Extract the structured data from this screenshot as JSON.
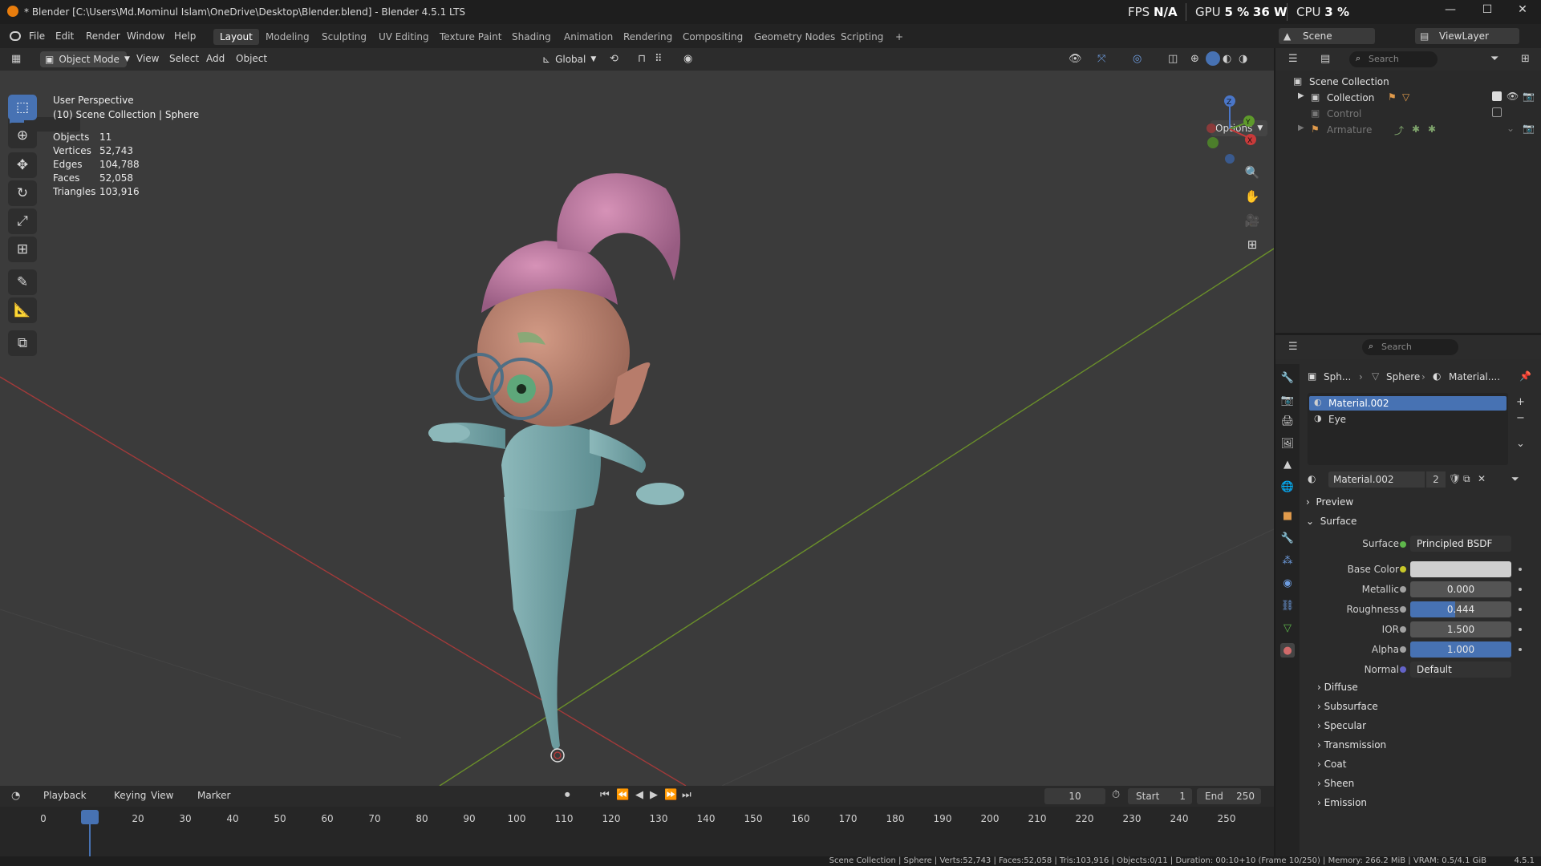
{
  "titlebar": {
    "title": "* Blender [C:\\Users\\Md.Mominul Islam\\OneDrive\\Desktop\\Blender.blend] - Blender 4.5.1 LTS",
    "fps_label": "FPS",
    "fps_value": "N/A",
    "gpu_label": "GPU",
    "gpu_value": "5 %",
    "gpu_power": "36 W",
    "cpu_label": "CPU",
    "cpu_value": "3 %",
    "minimize": "—",
    "maximize": "☐",
    "close": "✕"
  },
  "menubar": {
    "menus": [
      "File",
      "Edit",
      "Render",
      "Window",
      "Help"
    ],
    "workspaces": [
      "Layout",
      "Modeling",
      "Sculpting",
      "UV Editing",
      "Texture Paint",
      "Shading",
      "Animation",
      "Rendering",
      "Compositing",
      "Geometry Nodes",
      "Scripting"
    ],
    "active_workspace": "Layout",
    "add_tab": "+",
    "scene": "Scene",
    "view_layer": "ViewLayer"
  },
  "viewport": {
    "mode": "Object Mode",
    "menus": [
      "View",
      "Select",
      "Add",
      "Object"
    ],
    "orientation": "Global",
    "options": "Options",
    "perspective": "User Perspective",
    "context": "(10) Scene Collection | Sphere",
    "stats": [
      {
        "label": "Objects",
        "value": "11"
      },
      {
        "label": "Vertices",
        "value": "52,743"
      },
      {
        "label": "Edges",
        "value": "104,788"
      },
      {
        "label": "Faces",
        "value": "52,058"
      },
      {
        "label": "Triangles",
        "value": "103,916"
      }
    ],
    "tools": [
      "select-box-icon",
      "cursor-icon",
      "move-icon",
      "rotate-icon",
      "scale-icon",
      "transform-icon",
      "annotate-icon",
      "measure-icon",
      "add-cube-icon"
    ],
    "gizmo": {
      "x": "X",
      "y": "Y",
      "z": "Z"
    }
  },
  "timeline": {
    "menus": [
      "Playback",
      "Keying",
      "View",
      "Marker"
    ],
    "current_frame": "10",
    "start_label": "Start",
    "start": "1",
    "end_label": "End",
    "end": "250",
    "ticks": [
      "0",
      "10",
      "20",
      "30",
      "40",
      "50",
      "60",
      "70",
      "80",
      "90",
      "100",
      "110",
      "120",
      "130",
      "140",
      "150",
      "160",
      "170",
      "180",
      "190",
      "200",
      "210",
      "220",
      "230",
      "240",
      "250"
    ]
  },
  "outliner": {
    "search_placeholder": "Search",
    "items": [
      {
        "label": "Scene Collection"
      },
      {
        "label": "Collection"
      },
      {
        "label": "Control"
      },
      {
        "label": "Armature"
      }
    ]
  },
  "properties": {
    "search_placeholder": "Search",
    "breadcrumb": [
      "Sph...",
      "Sphere",
      "Material...."
    ],
    "slots": [
      "Material.002",
      "Eye"
    ],
    "material_name": "Material.002",
    "users": "2",
    "panels": {
      "preview": "Preview",
      "surface": "Surface"
    },
    "surface_label": "Surface",
    "surface_shader": "Principled BSDF",
    "fields": [
      {
        "label": "Base Color",
        "value": "",
        "fill": 0,
        "socket": "#c7c729"
      },
      {
        "label": "Metallic",
        "value": "0.000",
        "fill": 0,
        "socket": "#a1a1a1"
      },
      {
        "label": "Roughness",
        "value": "0.444",
        "fill": 0.444,
        "socket": "#a1a1a1"
      },
      {
        "label": "IOR",
        "value": "1.500",
        "fill": 0,
        "socket": "#a1a1a1"
      },
      {
        "label": "Alpha",
        "value": "1.000",
        "fill": 1,
        "socket": "#a1a1a1"
      },
      {
        "label": "Normal",
        "value": "Default",
        "fill": 0,
        "socket": "#6363c7"
      }
    ],
    "subpanels": [
      "Diffuse",
      "Subsurface",
      "Specular",
      "Transmission",
      "Coat",
      "Sheen",
      "Emission"
    ]
  },
  "statusbar": {
    "text": "Scene Collection | Sphere | Verts:52,743 | Faces:52,058 | Tris:103,916 | Objects:0/11 | Duration: 00:10+10 (Frame 10/250) | Memory: 266.2 MiB | VRAM: 0.5/4.1 GiB",
    "version": "4.5.1"
  },
  "colors": {
    "accent": "#4772b3",
    "viewport_bg": "#3b3b3b",
    "x_axis": "#b03a3a",
    "y_axis": "#6a8f2a"
  }
}
